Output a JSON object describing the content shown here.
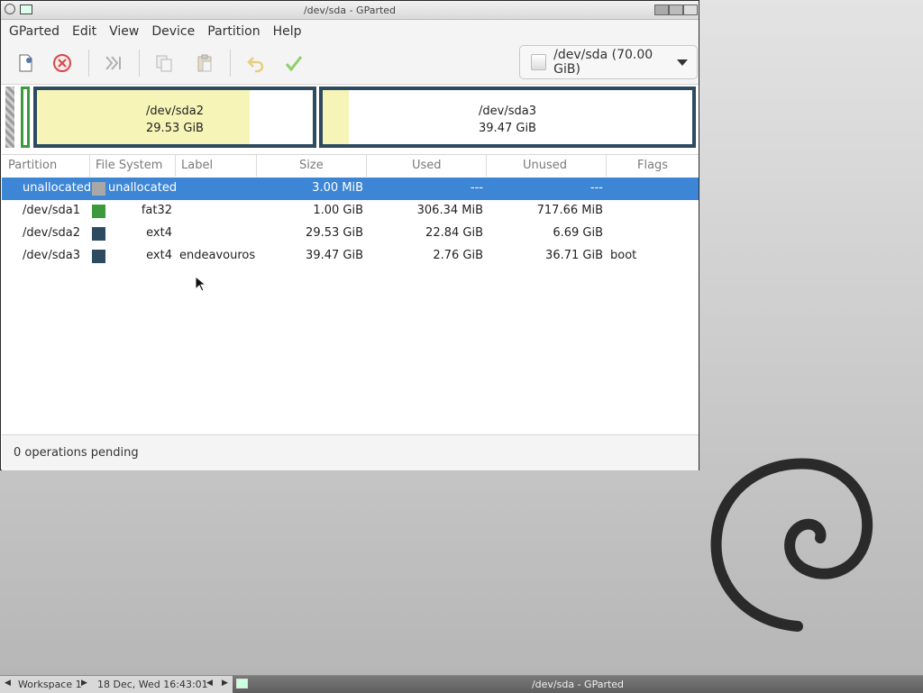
{
  "window": {
    "title": "/dev/sda - GParted"
  },
  "menu": [
    "GParted",
    "Edit",
    "View",
    "Device",
    "Partition",
    "Help"
  ],
  "toolbar": {
    "icons": [
      "new-partition-icon",
      "delete-icon",
      "resize-move-icon",
      "copy-icon",
      "paste-icon",
      "undo-icon",
      "apply-icon"
    ]
  },
  "device": {
    "label": "/dev/sda (70.00 GiB)"
  },
  "map": {
    "sda2": {
      "name": "/dev/sda2",
      "size": "29.53 GiB",
      "used_fraction": 0.77
    },
    "sda3": {
      "name": "/dev/sda3",
      "size": "39.47 GiB",
      "used_fraction": 0.07
    }
  },
  "columns": [
    "Partition",
    "File System",
    "Label",
    "Size",
    "Used",
    "Unused",
    "Flags"
  ],
  "rows": [
    {
      "partition": "unallocated",
      "fs": "unallocated",
      "label": "",
      "size": "3.00 MiB",
      "used": "---",
      "unused": "---",
      "flags": "",
      "color": "#a8a8a8"
    },
    {
      "partition": "/dev/sda1",
      "fs": "fat32",
      "label": "",
      "size": "1.00 GiB",
      "used": "306.34 MiB",
      "unused": "717.66 MiB",
      "flags": "",
      "color": "#3c9a3c"
    },
    {
      "partition": "/dev/sda2",
      "fs": "ext4",
      "label": "",
      "size": "29.53 GiB",
      "used": "22.84 GiB",
      "unused": "6.69 GiB",
      "flags": "",
      "color": "#2c4a60"
    },
    {
      "partition": "/dev/sda3",
      "fs": "ext4",
      "label": "endeavouros",
      "size": "39.47 GiB",
      "used": "2.76 GiB",
      "unused": "36.71 GiB",
      "flags": "boot",
      "color": "#2c4a60"
    }
  ],
  "status": "0 operations pending",
  "panel": {
    "workspace": "Workspace 1",
    "datetime": "18 Dec, Wed 16:43:01",
    "task": "/dev/sda - GParted"
  }
}
